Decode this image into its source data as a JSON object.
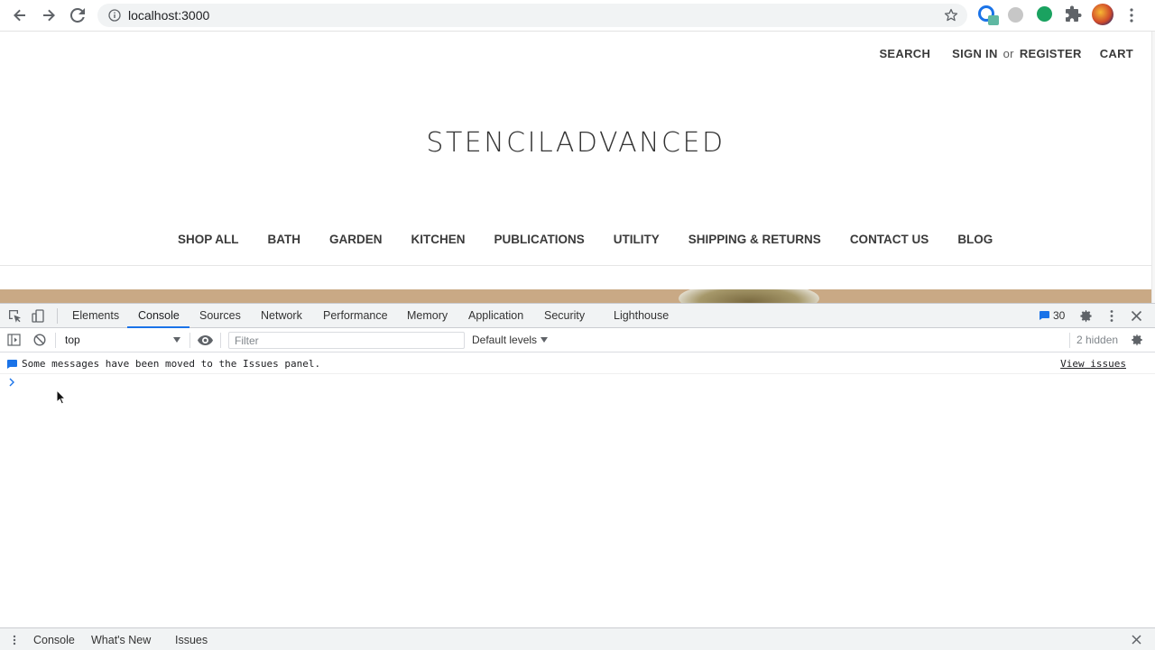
{
  "browser": {
    "url": "localhost:3000"
  },
  "site": {
    "top_nav": {
      "search": "SEARCH",
      "sign_in": "SIGN IN",
      "or": "or",
      "register": "REGISTER",
      "cart": "CART"
    },
    "logo": "STENCILADVANCED",
    "categories": [
      "SHOP ALL",
      "BATH",
      "GARDEN",
      "KITCHEN",
      "PUBLICATIONS",
      "UTILITY",
      "SHIPPING & RETURNS",
      "CONTACT US",
      "BLOG"
    ]
  },
  "devtools": {
    "tabs": [
      "Elements",
      "Console",
      "Sources",
      "Network",
      "Performance",
      "Memory",
      "Application",
      "Security",
      "Lighthouse"
    ],
    "active_tab": "Console",
    "issues_count": "30",
    "console": {
      "context": "top",
      "filter_placeholder": "Filter",
      "levels": "Default levels",
      "hidden": "2 hidden",
      "message": "Some messages have been moved to the Issues panel.",
      "view_issues": "View issues"
    },
    "drawer_tabs": [
      "Console",
      "What's New",
      "Issues"
    ]
  },
  "colors": {
    "accent": "#1a73e8",
    "hero_band": "#c9a985"
  }
}
